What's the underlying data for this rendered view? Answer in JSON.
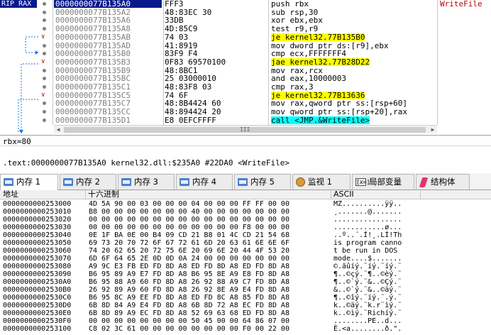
{
  "disasm": {
    "rip_label": "RIP RAX",
    "selected_index": 0,
    "rows": [
      {
        "addr": "0000000077B135A0",
        "bytes": "FFF3",
        "instr": "push rbx",
        "comment": "WriteFile",
        "type": "normal"
      },
      {
        "addr": "0000000077B135A2",
        "bytes": "48:83EC 30",
        "instr": "sub rsp,30",
        "comment": "",
        "type": "normal"
      },
      {
        "addr": "0000000077B135A6",
        "bytes": "33DB",
        "instr": "xor ebx,ebx",
        "comment": "",
        "type": "normal"
      },
      {
        "addr": "0000000077B135A8",
        "bytes": "4D:85C9",
        "instr": "test r9,r9",
        "comment": "",
        "type": "normal"
      },
      {
        "addr": "0000000077B135AB",
        "bytes": "74 03",
        "instr": "je kernel32.77B135B0",
        "comment": "",
        "type": "jmp"
      },
      {
        "addr": "0000000077B135AD",
        "bytes": "41:8919",
        "instr": "mov dword ptr ds:[r9],ebx",
        "comment": "",
        "type": "normal"
      },
      {
        "addr": "0000000077B135B0",
        "bytes": "83F9 F4",
        "instr": "cmp ecx,FFFFFFF4",
        "comment": "",
        "type": "normal"
      },
      {
        "addr": "0000000077B135B3",
        "bytes": "0F83 69570100",
        "instr": "jae kernel32.77B28D22",
        "comment": "",
        "type": "jmp"
      },
      {
        "addr": "0000000077B135B9",
        "bytes": "48:8BC1",
        "instr": "mov rax,rcx",
        "comment": "",
        "type": "normal"
      },
      {
        "addr": "0000000077B135BC",
        "bytes": "25 03000010",
        "instr": "and eax,10000003",
        "comment": "",
        "type": "normal"
      },
      {
        "addr": "0000000077B135C1",
        "bytes": "48:83F8 03",
        "instr": "cmp rax,3",
        "comment": "",
        "type": "normal"
      },
      {
        "addr": "0000000077B135C5",
        "bytes": "74 6F",
        "instr": "je kernel32.77B13636",
        "comment": "",
        "type": "jmp"
      },
      {
        "addr": "0000000077B135C7",
        "bytes": "48:8B4424 60",
        "instr": "mov rax,qword ptr ss:[rsp+60]",
        "comment": "",
        "type": "normal"
      },
      {
        "addr": "0000000077B135CC",
        "bytes": "48:894424 20",
        "instr": "mov qword ptr ss:[rsp+20],rax",
        "comment": "",
        "type": "normal"
      },
      {
        "addr": "0000000077B135D1",
        "bytes": "E8 0EFCFFFF",
        "instr": "call <JMP.&WriteFile>",
        "comment": "",
        "type": "call"
      }
    ],
    "scroll_grip": "III"
  },
  "info": {
    "register_line": "rbx=80",
    "text_line": ".text:0000000077B135A0 kernel32.dll:$235A0 #22DA0 <WriteFile>"
  },
  "tabs": [
    {
      "label": "内存 1",
      "icon": "memory-icon",
      "active": true
    },
    {
      "label": "内存 2",
      "icon": "memory-icon",
      "active": false
    },
    {
      "label": "内存 3",
      "icon": "memory-icon",
      "active": false
    },
    {
      "label": "内存 4",
      "icon": "memory-icon",
      "active": false
    },
    {
      "label": "内存 5",
      "icon": "memory-icon",
      "active": false
    },
    {
      "label": "监视 1",
      "icon": "watch-icon",
      "active": false
    },
    {
      "label": "局部变量",
      "icon": "variables-icon",
      "active": false
    },
    {
      "label": "结构体",
      "icon": "struct-icon",
      "active": false
    }
  ],
  "dump": {
    "headers": {
      "address": "地址",
      "hex": "十六进制",
      "ascii": "ASCII"
    },
    "rows": [
      {
        "addr": "0000000000253000",
        "hex": "4D 5A 90 00 03 00 00 00 04 00 00 00 FF FF 00 00",
        "ascii": "MZ..........ÿÿ.."
      },
      {
        "addr": "0000000000253010",
        "hex": "B8 00 00 00 00 00 00 00 40 00 00 00 00 00 00 00",
        "ascii": "¸.......@......."
      },
      {
        "addr": "0000000000253020",
        "hex": "00 00 00 00 00 00 00 00 00 00 00 00 00 00 00 00",
        "ascii": "................"
      },
      {
        "addr": "0000000000253030",
        "hex": "00 00 00 00 00 00 00 00 00 00 00 00 F8 00 00 00",
        "ascii": "............ø..."
      },
      {
        "addr": "0000000000253040",
        "hex": "0E 1F BA 0E 00 B4 09 CD 21 B8 01 4C CD 21 54 68",
        "ascii": "..º..´.Í!¸.LÍ!Th"
      },
      {
        "addr": "0000000000253050",
        "hex": "69 73 20 70 72 6F 67 72 61 6D 20 63 61 6E 6E 6F",
        "ascii": "is program canno"
      },
      {
        "addr": "0000000000253060",
        "hex": "74 20 62 65 20 72 75 6E 20 69 6E 20 44 4F 53 20",
        "ascii": "t be run in DOS "
      },
      {
        "addr": "0000000000253070",
        "hex": "6D 6F 64 65 2E 0D 0D 0A 24 00 00 00 00 00 00 00",
        "ascii": "mode....$......."
      },
      {
        "addr": "0000000000253080",
        "hex": "A9 9C E3 FB ED FD 8D A8 ED FD 8D A8 ED FD 8D A8",
        "ascii": "©.ãûíý.¨íý.¨íý.¨"
      },
      {
        "addr": "0000000000253090",
        "hex": "B6 95 89 A9 E7 FD 8D A8 B6 95 8E A9 E8 FD 8D A8",
        "ascii": "¶..©çý.¨¶..©èý.¨"
      },
      {
        "addr": "00000000002530A0",
        "hex": "B6 95 88 A9 60 FD 8D A8 26 92 88 A9 C7 FD 8D A8",
        "ascii": "¶..©`ý.¨&..©Çý.¨"
      },
      {
        "addr": "00000000002530B0",
        "hex": "26 92 89 A9 60 FD 8D A8 26 92 8E A9 E4 FD 8D A8",
        "ascii": "&..©`ý.¨&..©äý.¨"
      },
      {
        "addr": "00000000002530C0",
        "hex": "B6 95 8C A9 EE FD 8D A8 ED FD 8C A8 85 FD 8D A8",
        "ascii": "¶..©îý.¨íý.¨.ý.¨"
      },
      {
        "addr": "00000000002530D0",
        "hex": "6B 8D 84 A9 E4 FD 8D A8 6B 8D 72 A8 EC FD 8D A8",
        "ascii": "k..©äý.¨k.r¨ìý.¨"
      },
      {
        "addr": "00000000002530E0",
        "hex": "6B 8D 89 A9 EC FD 8D A8 52 69 63 68 ED FD 8D A8",
        "ascii": "k..©ìý.¨Richíý.¨"
      },
      {
        "addr": "00000000002530F0",
        "hex": "00 00 00 00 00 00 00 00 50 45 00 00 64 86 07 00",
        "ascii": "........PE..d..."
      },
      {
        "addr": "0000000000253100",
        "hex": "C8 02 3C 61 00 00 00 00 00 00 00 00 F0 00 22 00",
        "ascii": "È.<a........ð.\"."
      }
    ]
  }
}
